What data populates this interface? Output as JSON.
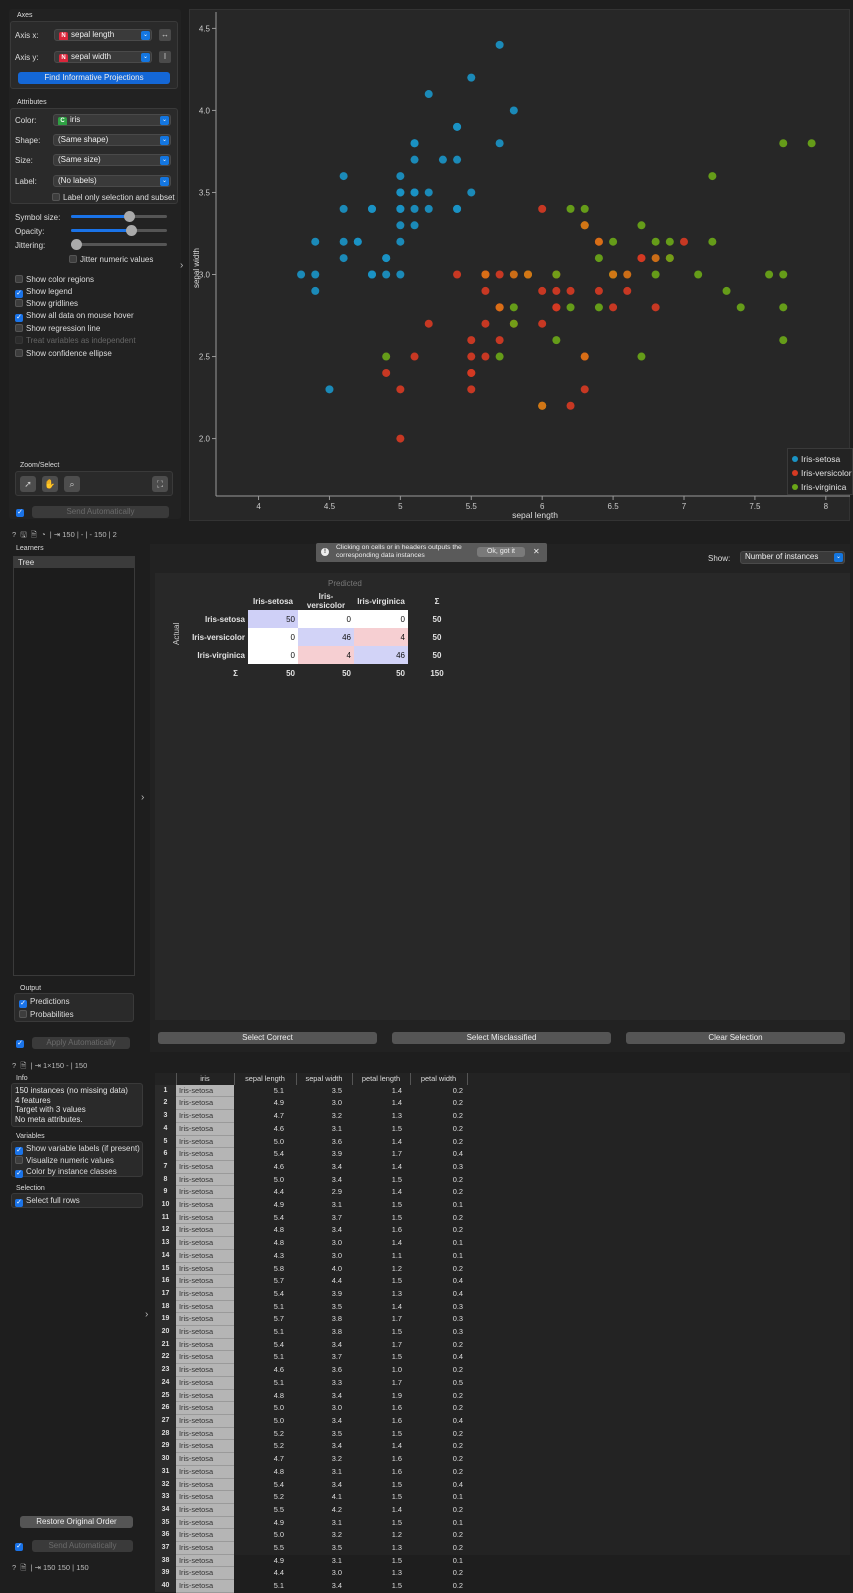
{
  "scatter": {
    "axes_title": "Axes",
    "axis_x_label": "Axis x:",
    "axis_x_value": "sepal length",
    "axis_y_label": "Axis y:",
    "axis_y_value": "sepal width",
    "find_button": "Find Informative Projections",
    "attributes_title": "Attributes",
    "color_label": "Color:",
    "color_value": "iris",
    "shape_label": "Shape:",
    "shape_value": "(Same shape)",
    "size_label": "Size:",
    "size_value": "(Same size)",
    "label_label": "Label:",
    "label_value": "(No labels)",
    "label_only": "Label only selection and subset",
    "symbol_size": "Symbol size:",
    "opacity": "Opacity:",
    "jittering": "Jittering:",
    "jitter_numeric": "Jitter numeric values",
    "symbol_size_level": 0.6,
    "opacity_level": 0.62,
    "jitter_level": 0.05,
    "opt_color_regions": "Show color regions",
    "opt_legend": "Show legend",
    "opt_gridlines": "Show gridlines",
    "opt_all_data": "Show all data on mouse hover",
    "opt_regression": "Show regression line",
    "opt_independent": "Treat variables as independent",
    "opt_ellipse": "Show confidence ellipse",
    "zoom_title": "Zoom/Select",
    "send_button": "Send Automatically",
    "status": "150 | - | -  150 | 2",
    "colors": {
      "setosa": "#1a93c4",
      "versicolor": "#d53a23",
      "virginica": "#6aa618",
      "orange": "#d97316"
    }
  },
  "chart_data": {
    "type": "scatter",
    "xlabel": "sepal length",
    "ylabel": "sepal width",
    "xlim": [
      3.7,
      8.1
    ],
    "ylim": [
      1.65,
      4.6
    ],
    "xticks": [
      "4",
      "4.5",
      "5",
      "5.5",
      "6",
      "6.5",
      "7",
      "7.5",
      "8"
    ],
    "yticks": [
      "2.0",
      "2.5",
      "3.0",
      "3.5",
      "4.0",
      "4.5"
    ],
    "legend_position": "bottom-right",
    "series": [
      {
        "name": "Iris-setosa",
        "color": "#1a93c4",
        "points": [
          [
            5.1,
            3.5
          ],
          [
            4.9,
            3.0
          ],
          [
            4.7,
            3.2
          ],
          [
            4.6,
            3.1
          ],
          [
            5.0,
            3.6
          ],
          [
            5.4,
            3.9
          ],
          [
            4.6,
            3.4
          ],
          [
            5.0,
            3.4
          ],
          [
            4.4,
            2.9
          ],
          [
            4.9,
            3.1
          ],
          [
            5.4,
            3.7
          ],
          [
            4.8,
            3.4
          ],
          [
            4.8,
            3.0
          ],
          [
            4.3,
            3.0
          ],
          [
            5.8,
            4.0
          ],
          [
            5.7,
            4.4
          ],
          [
            5.4,
            3.9
          ],
          [
            5.1,
            3.5
          ],
          [
            5.7,
            3.8
          ],
          [
            5.1,
            3.8
          ],
          [
            5.4,
            3.4
          ],
          [
            5.1,
            3.7
          ],
          [
            4.6,
            3.6
          ],
          [
            5.1,
            3.3
          ],
          [
            4.8,
            3.4
          ],
          [
            5.0,
            3.0
          ],
          [
            5.0,
            3.4
          ],
          [
            5.2,
            3.5
          ],
          [
            5.2,
            3.4
          ],
          [
            4.7,
            3.2
          ],
          [
            5.4,
            3.4
          ],
          [
            5.2,
            4.1
          ],
          [
            5.5,
            4.2
          ],
          [
            4.9,
            3.1
          ],
          [
            5.0,
            3.2
          ],
          [
            5.5,
            3.5
          ],
          [
            4.4,
            3.0
          ],
          [
            5.1,
            3.4
          ],
          [
            5.0,
            3.5
          ],
          [
            4.5,
            2.3
          ],
          [
            4.4,
            3.2
          ],
          [
            5.0,
            3.5
          ],
          [
            5.1,
            3.8
          ],
          [
            4.8,
            3.0
          ],
          [
            4.6,
            3.2
          ],
          [
            5.3,
            3.7
          ],
          [
            5.0,
            3.3
          ]
        ]
      },
      {
        "name": "Iris-versicolor",
        "color": "#d53a23",
        "points": [
          [
            7.0,
            3.2
          ],
          [
            6.4,
            3.2
          ],
          [
            6.9,
            3.1
          ],
          [
            5.5,
            2.3
          ],
          [
            6.5,
            2.8
          ],
          [
            5.7,
            2.8
          ],
          [
            6.3,
            3.3
          ],
          [
            4.9,
            2.4
          ],
          [
            6.6,
            2.9
          ],
          [
            5.2,
            2.7
          ],
          [
            5.0,
            2.0
          ],
          [
            5.9,
            3.0
          ],
          [
            6.0,
            2.2
          ],
          [
            6.1,
            2.9
          ],
          [
            5.6,
            2.9
          ],
          [
            6.7,
            3.1
          ],
          [
            5.6,
            3.0
          ],
          [
            5.8,
            2.7
          ],
          [
            6.2,
            2.2
          ],
          [
            5.6,
            2.5
          ],
          [
            6.1,
            2.8
          ],
          [
            6.3,
            2.5
          ],
          [
            6.1,
            2.8
          ],
          [
            6.4,
            2.9
          ],
          [
            6.8,
            2.8
          ],
          [
            6.0,
            2.9
          ],
          [
            5.7,
            2.6
          ],
          [
            5.5,
            2.4
          ],
          [
            5.5,
            2.4
          ],
          [
            6.0,
            2.7
          ],
          [
            5.4,
            3.0
          ],
          [
            6.0,
            3.4
          ],
          [
            6.7,
            3.1
          ],
          [
            6.3,
            2.3
          ],
          [
            5.6,
            3.0
          ],
          [
            5.5,
            2.5
          ],
          [
            5.5,
            2.6
          ],
          [
            6.1,
            3.0
          ],
          [
            5.0,
            2.3
          ],
          [
            5.6,
            2.7
          ],
          [
            5.7,
            3.0
          ],
          [
            6.2,
            2.9
          ],
          [
            5.1,
            2.5
          ],
          [
            5.7,
            2.8
          ]
        ]
      },
      {
        "name": "Iris-virginica",
        "color": "#6aa618",
        "points": [
          [
            6.3,
            3.3
          ],
          [
            7.1,
            3.0
          ],
          [
            6.5,
            3.0
          ],
          [
            7.6,
            3.0
          ],
          [
            4.9,
            2.5
          ],
          [
            7.3,
            2.9
          ],
          [
            7.2,
            3.6
          ],
          [
            6.5,
            3.2
          ],
          [
            6.8,
            3.0
          ],
          [
            5.7,
            2.5
          ],
          [
            5.8,
            2.8
          ],
          [
            7.7,
            3.8
          ],
          [
            7.7,
            2.6
          ],
          [
            6.0,
            2.2
          ],
          [
            6.9,
            3.2
          ],
          [
            7.7,
            2.8
          ],
          [
            6.7,
            3.3
          ],
          [
            7.2,
            3.2
          ],
          [
            6.2,
            2.8
          ],
          [
            6.1,
            3.0
          ],
          [
            6.4,
            2.8
          ],
          [
            7.4,
            2.8
          ],
          [
            7.9,
            3.8
          ],
          [
            6.1,
            2.6
          ],
          [
            7.7,
            3.0
          ],
          [
            6.3,
            3.4
          ],
          [
            6.4,
            3.1
          ],
          [
            6.9,
            3.1
          ],
          [
            5.8,
            2.7
          ],
          [
            6.8,
            3.2
          ],
          [
            6.7,
            2.5
          ],
          [
            6.2,
            3.4
          ],
          [
            5.9,
            3.0
          ],
          [
            6.5,
            3.0
          ]
        ]
      },
      {
        "name": "",
        "color": "#d97316",
        "points": [
          [
            5.6,
            3.0
          ],
          [
            6.3,
            3.3
          ],
          [
            6.5,
            3.0
          ],
          [
            6.3,
            2.5
          ],
          [
            5.7,
            2.8
          ],
          [
            6.4,
            3.2
          ],
          [
            6.6,
            3.0
          ],
          [
            5.8,
            3.0
          ],
          [
            6.0,
            2.2
          ],
          [
            5.9,
            3.0
          ],
          [
            6.8,
            3.1
          ]
        ]
      }
    ]
  },
  "confusion": {
    "learners_title": "Learners",
    "learner": "Tree",
    "tip": "Clicking on cells or in headers outputs the corresponding data instances",
    "tip_button": "Ok, got it",
    "show_label": "Show:",
    "show_value": "Number of instances",
    "predicted": "Predicted",
    "actual": "Actual",
    "classes": [
      "Iris-setosa",
      "Iris-versicolor",
      "Iris-virginica"
    ],
    "sigma": "Σ",
    "matrix": [
      [
        "50",
        "0",
        "0"
      ],
      [
        "0",
        "46",
        "4"
      ],
      [
        "0",
        "4",
        "46"
      ]
    ],
    "row_sums": [
      "50",
      "50",
      "50"
    ],
    "col_sums": [
      "50",
      "50",
      "50"
    ],
    "total": "150",
    "output_title": "Output",
    "opt_predictions": "Predictions",
    "opt_probabilities": "Probabilities",
    "apply_button": "Apply Automatically",
    "select_correct": "Select Correct",
    "select_misclassified": "Select Misclassified",
    "clear_selection": "Clear Selection"
  },
  "table": {
    "status": "1×150   - | 150",
    "info_title": "Info",
    "info_lines": [
      "150 instances (no missing data)",
      "4 features",
      "Target with 3 values",
      "No meta attributes."
    ],
    "variables_title": "Variables",
    "opt_labels": "Show variable labels (if present)",
    "opt_visualize": "Visualize numeric values",
    "opt_color": "Color by instance classes",
    "selection_title": "Selection",
    "opt_full_rows": "Select full rows",
    "restore_button": "Restore Original Order",
    "send_button": "Send Automatically",
    "columns": [
      "iris",
      "sepal length",
      "sepal width",
      "petal length",
      "petal width"
    ],
    "rows": [
      [
        "Iris-setosa",
        "5.1",
        "3.5",
        "1.4",
        "0.2"
      ],
      [
        "Iris-setosa",
        "4.9",
        "3.0",
        "1.4",
        "0.2"
      ],
      [
        "Iris-setosa",
        "4.7",
        "3.2",
        "1.3",
        "0.2"
      ],
      [
        "Iris-setosa",
        "4.6",
        "3.1",
        "1.5",
        "0.2"
      ],
      [
        "Iris-setosa",
        "5.0",
        "3.6",
        "1.4",
        "0.2"
      ],
      [
        "Iris-setosa",
        "5.4",
        "3.9",
        "1.7",
        "0.4"
      ],
      [
        "Iris-setosa",
        "4.6",
        "3.4",
        "1.4",
        "0.3"
      ],
      [
        "Iris-setosa",
        "5.0",
        "3.4",
        "1.5",
        "0.2"
      ],
      [
        "Iris-setosa",
        "4.4",
        "2.9",
        "1.4",
        "0.2"
      ],
      [
        "Iris-setosa",
        "4.9",
        "3.1",
        "1.5",
        "0.1"
      ],
      [
        "Iris-setosa",
        "5.4",
        "3.7",
        "1.5",
        "0.2"
      ],
      [
        "Iris-setosa",
        "4.8",
        "3.4",
        "1.6",
        "0.2"
      ],
      [
        "Iris-setosa",
        "4.8",
        "3.0",
        "1.4",
        "0.1"
      ],
      [
        "Iris-setosa",
        "4.3",
        "3.0",
        "1.1",
        "0.1"
      ],
      [
        "Iris-setosa",
        "5.8",
        "4.0",
        "1.2",
        "0.2"
      ],
      [
        "Iris-setosa",
        "5.7",
        "4.4",
        "1.5",
        "0.4"
      ],
      [
        "Iris-setosa",
        "5.4",
        "3.9",
        "1.3",
        "0.4"
      ],
      [
        "Iris-setosa",
        "5.1",
        "3.5",
        "1.4",
        "0.3"
      ],
      [
        "Iris-setosa",
        "5.7",
        "3.8",
        "1.7",
        "0.3"
      ],
      [
        "Iris-setosa",
        "5.1",
        "3.8",
        "1.5",
        "0.3"
      ],
      [
        "Iris-setosa",
        "5.4",
        "3.4",
        "1.7",
        "0.2"
      ],
      [
        "Iris-setosa",
        "5.1",
        "3.7",
        "1.5",
        "0.4"
      ],
      [
        "Iris-setosa",
        "4.6",
        "3.6",
        "1.0",
        "0.2"
      ],
      [
        "Iris-setosa",
        "5.1",
        "3.3",
        "1.7",
        "0.5"
      ],
      [
        "Iris-setosa",
        "4.8",
        "3.4",
        "1.9",
        "0.2"
      ],
      [
        "Iris-setosa",
        "5.0",
        "3.0",
        "1.6",
        "0.2"
      ],
      [
        "Iris-setosa",
        "5.0",
        "3.4",
        "1.6",
        "0.4"
      ],
      [
        "Iris-setosa",
        "5.2",
        "3.5",
        "1.5",
        "0.2"
      ],
      [
        "Iris-setosa",
        "5.2",
        "3.4",
        "1.4",
        "0.2"
      ],
      [
        "Iris-setosa",
        "4.7",
        "3.2",
        "1.6",
        "0.2"
      ],
      [
        "Iris-setosa",
        "4.8",
        "3.1",
        "1.6",
        "0.2"
      ],
      [
        "Iris-setosa",
        "5.4",
        "3.4",
        "1.5",
        "0.4"
      ],
      [
        "Iris-setosa",
        "5.2",
        "4.1",
        "1.5",
        "0.1"
      ],
      [
        "Iris-setosa",
        "5.5",
        "4.2",
        "1.4",
        "0.2"
      ],
      [
        "Iris-setosa",
        "4.9",
        "3.1",
        "1.5",
        "0.1"
      ],
      [
        "Iris-setosa",
        "5.0",
        "3.2",
        "1.2",
        "0.2"
      ],
      [
        "Iris-setosa",
        "5.5",
        "3.5",
        "1.3",
        "0.2"
      ],
      [
        "Iris-setosa",
        "4.9",
        "3.1",
        "1.5",
        "0.1"
      ],
      [
        "Iris-setosa",
        "4.4",
        "3.0",
        "1.3",
        "0.2"
      ],
      [
        "Iris-setosa",
        "5.1",
        "3.4",
        "1.5",
        "0.2"
      ]
    ],
    "footer_status": "150   150 | 150"
  }
}
